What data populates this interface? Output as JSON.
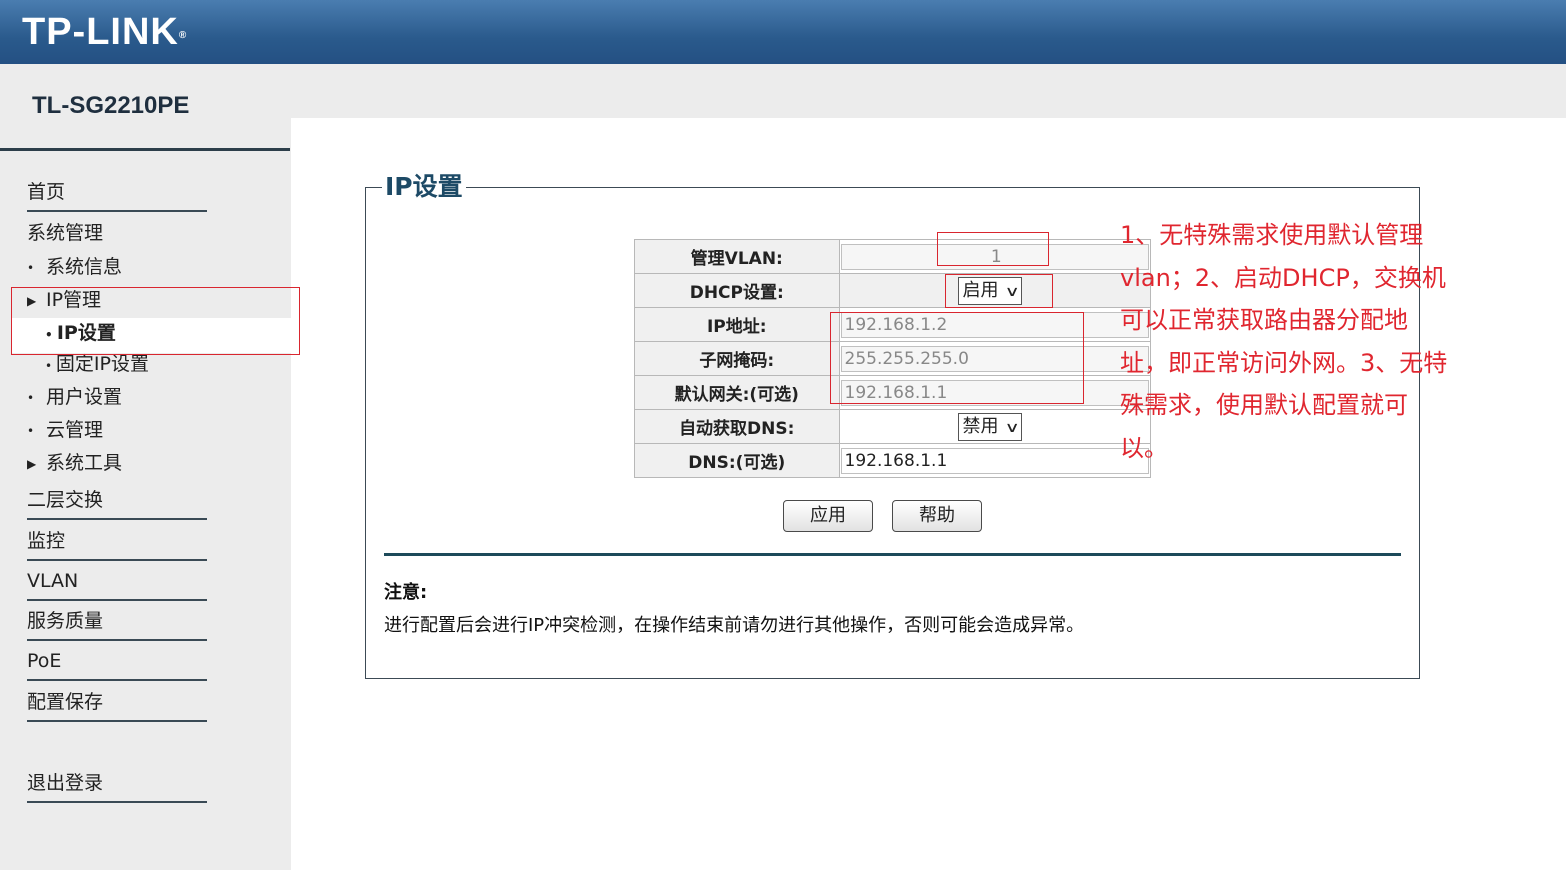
{
  "header": {
    "logo": "TP-LINK",
    "logo_mark": "®",
    "model": "TL-SG2210PE"
  },
  "sidebar": {
    "home": "首页",
    "system_mgmt": "系统管理",
    "system_info": "系统信息",
    "ip_mgmt": "IP管理",
    "ip_settings": "IP设置",
    "static_ip": "固定IP设置",
    "user_settings": "用户设置",
    "cloud_mgmt": "云管理",
    "system_tools": "系统工具",
    "layer2": "二层交换",
    "monitor": "监控",
    "vlan": "VLAN",
    "qos": "服务质量",
    "poe": "PoE",
    "save_config": "配置保存",
    "logout": "退出登录"
  },
  "panel": {
    "title": "IP设置",
    "fields": {
      "mgmt_vlan_label": "管理VLAN:",
      "mgmt_vlan_value": "1",
      "dhcp_label": "DHCP设置:",
      "dhcp_value": "启用",
      "ip_label": "IP地址:",
      "ip_value": "192.168.1.2",
      "mask_label": "子网掩码:",
      "mask_value": "255.255.255.0",
      "gateway_label": "默认网关:(可选)",
      "gateway_value": "192.168.1.1",
      "auto_dns_label": "自动获取DNS:",
      "auto_dns_value": "禁用",
      "dns_label": "DNS:(可选)",
      "dns_value": "192.168.1.1"
    },
    "apply_label": "应用",
    "help_label": "帮助",
    "note_title": "注意:",
    "note_text": "进行配置后会进行IP冲突检测，在操作结束前请勿进行其他操作，否则可能会造成异常。"
  },
  "annotation": {
    "text": "1、无特殊需求使用默认管理vlan；2、启动DHCP，交换机可以正常获取路由器分配地址，即正常访问外网。3、无特殊需求，使用默认配置就可以。"
  }
}
